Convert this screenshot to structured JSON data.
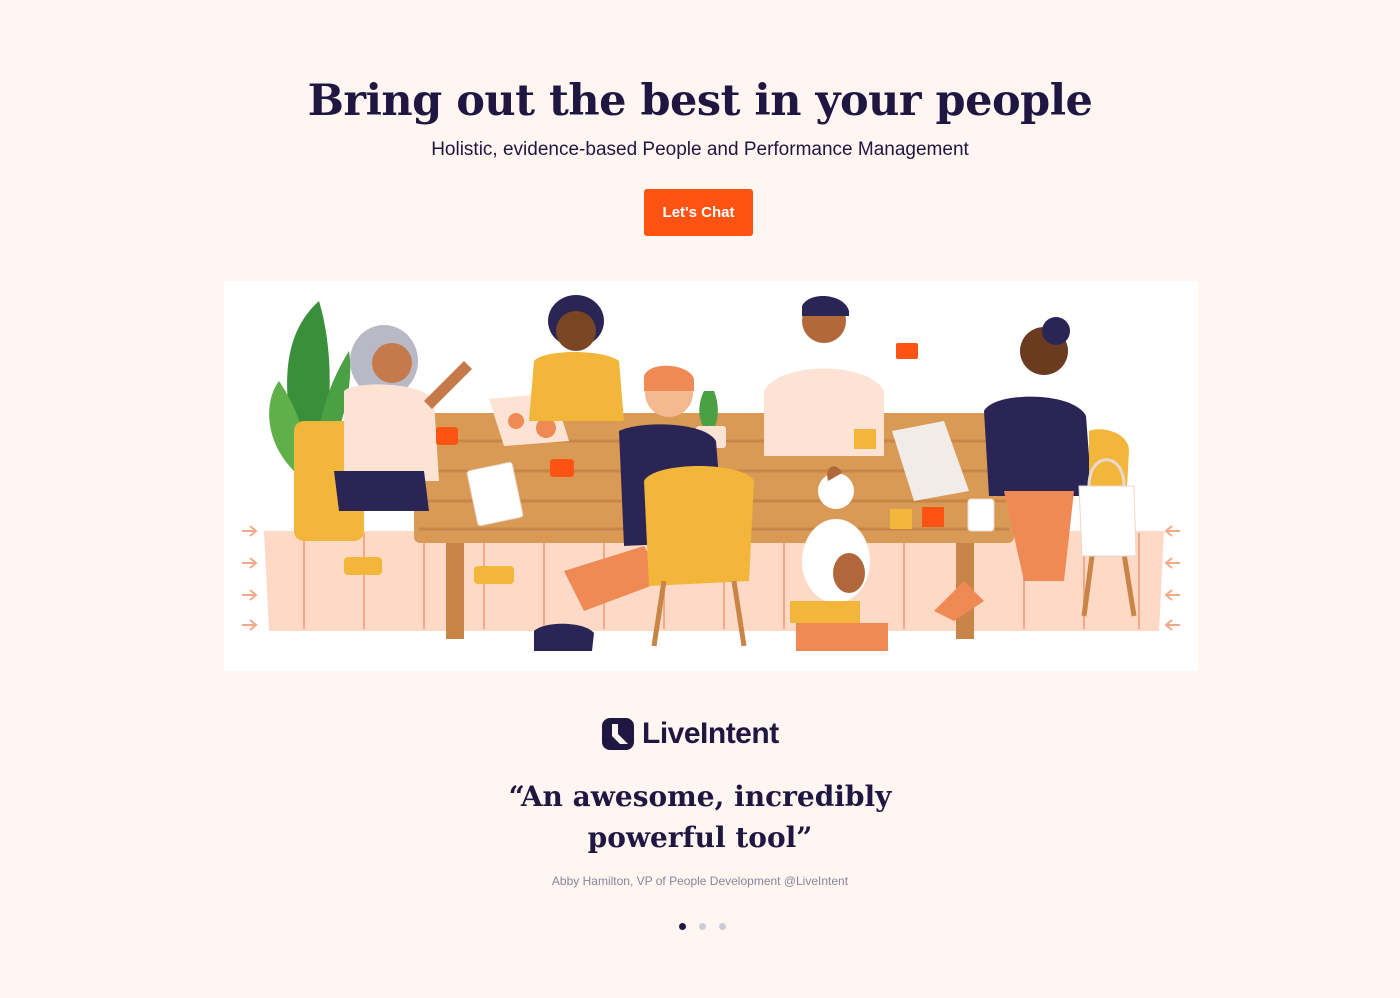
{
  "hero": {
    "title": "Bring out the best in your people",
    "subtitle": "Holistic, evidence-based People and Performance Management",
    "cta_label": "Let's Chat"
  },
  "illustration": {
    "icon": "team-meeting-illustration"
  },
  "testimonial": {
    "company_logo_text": "LiveIntent",
    "quote_line1": "“An awesome, incredibly",
    "quote_line2": "powerful tool”",
    "attribution": "Abby Hamilton, VP of People Development @LiveIntent"
  },
  "carousel": {
    "total": 3,
    "active_index": 0
  },
  "colors": {
    "background": "#fff6f2",
    "primary_text": "#1f1742",
    "accent": "#ff5314",
    "muted_text": "#8a8499"
  }
}
